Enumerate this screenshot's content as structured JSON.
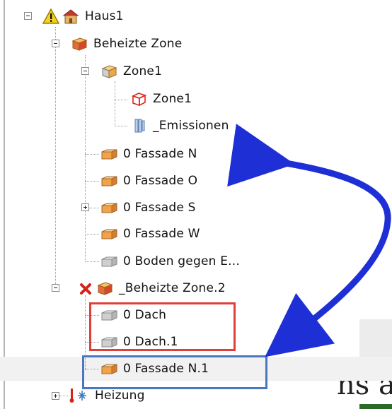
{
  "tree": {
    "nodes": [
      {
        "id": "haus1",
        "label": "Haus1"
      },
      {
        "id": "beheizte-zone",
        "label": "Beheizte Zone"
      },
      {
        "id": "zone1-group",
        "label": "Zone1"
      },
      {
        "id": "zone1-child",
        "label": "Zone1"
      },
      {
        "id": "emissionen",
        "label": "_Emissionen"
      },
      {
        "id": "fassade-n",
        "label": "0 Fassade N"
      },
      {
        "id": "fassade-o",
        "label": "0 Fassade O"
      },
      {
        "id": "fassade-s",
        "label": "0 Fassade S"
      },
      {
        "id": "fassade-w",
        "label": "0 Fassade W"
      },
      {
        "id": "boden",
        "label": "0 Boden gegen E..."
      },
      {
        "id": "beheizte-zone-2",
        "label": "_Beheizte Zone.2"
      },
      {
        "id": "dach",
        "label": "0 Dach"
      },
      {
        "id": "dach-1",
        "label": "0 Dach.1"
      },
      {
        "id": "fassade-n-1",
        "label": "0 Fassade N.1"
      },
      {
        "id": "heizung",
        "label": "Heizung"
      }
    ]
  },
  "background_text": "ns a",
  "colors": {
    "arrow": "#1f2fd6",
    "red_box": "#e0403a",
    "blue_box": "#4a76c2"
  }
}
